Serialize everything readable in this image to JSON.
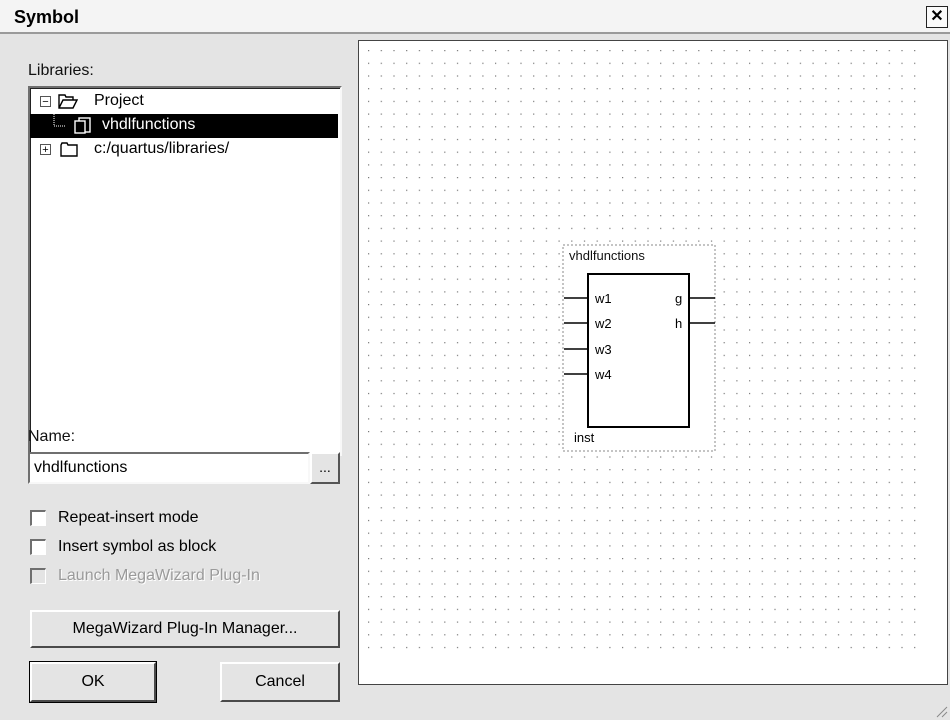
{
  "window": {
    "title": "Symbol",
    "close_glyph": "✕"
  },
  "libraries": {
    "label": "Libraries:",
    "items": [
      {
        "label": "Project",
        "expander": "−",
        "icon": "open-folder-icon"
      },
      {
        "label": "vhdlfunctions",
        "icon": "symbol-file-icon",
        "selected": true
      },
      {
        "label": "c:/quartus/libraries/",
        "expander": "+",
        "icon": "folder-icon"
      }
    ]
  },
  "name": {
    "label": "Name:",
    "value": "vhdlfunctions",
    "browse_label": "..."
  },
  "options": {
    "repeat_insert": {
      "label": "Repeat-insert mode",
      "checked": false
    },
    "insert_as_block": {
      "label": "Insert symbol as block",
      "checked": false
    },
    "launch_megawizard": {
      "label": "Launch MegaWizard Plug-In",
      "checked": false,
      "disabled": true
    }
  },
  "buttons": {
    "megawizard_manager": "MegaWizard Plug-In Manager...",
    "ok": "OK",
    "cancel": "Cancel"
  },
  "symbol": {
    "name": "vhdlfunctions",
    "instance": "inst",
    "inputs": [
      "w1",
      "w2",
      "w3",
      "w4"
    ],
    "outputs": [
      "g",
      "h"
    ]
  },
  "colors": {
    "selection": "#000000",
    "dialog_bg": "#e4e4e4",
    "grid_dot": "#777777"
  }
}
